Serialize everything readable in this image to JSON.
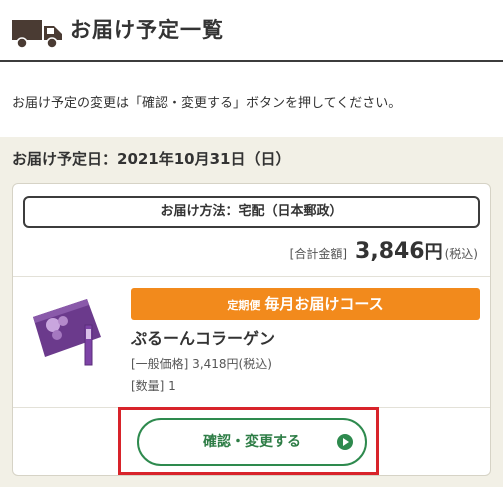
{
  "header": {
    "title": "お届け予定一覧",
    "icon": "truck-icon"
  },
  "notice": "お届け予定の変更は「確認・変更する」ボタンを押してください。",
  "delivery": {
    "date_line": "お届け予定日：2021年10月31日（日）",
    "method": "お届け方法：宅配（日本郵政）",
    "total_label": "[合計金額]",
    "total_amount": "3,846",
    "total_yen": "円",
    "total_tax": "(税込)"
  },
  "product": {
    "course_small": "定期便",
    "course_big": "毎月お届けコース",
    "name": "ぷるーんコラーゲン",
    "price": "[一般価格] 3,418円(税込)",
    "quantity": "[数量] 1"
  },
  "actions": {
    "confirm_label": "確認・変更する"
  },
  "colors": {
    "accent_orange": "#f28a1c",
    "button_green": "#2e8a4e",
    "highlight_red": "#d8232a",
    "beige_bg": "#f2f0e6"
  }
}
